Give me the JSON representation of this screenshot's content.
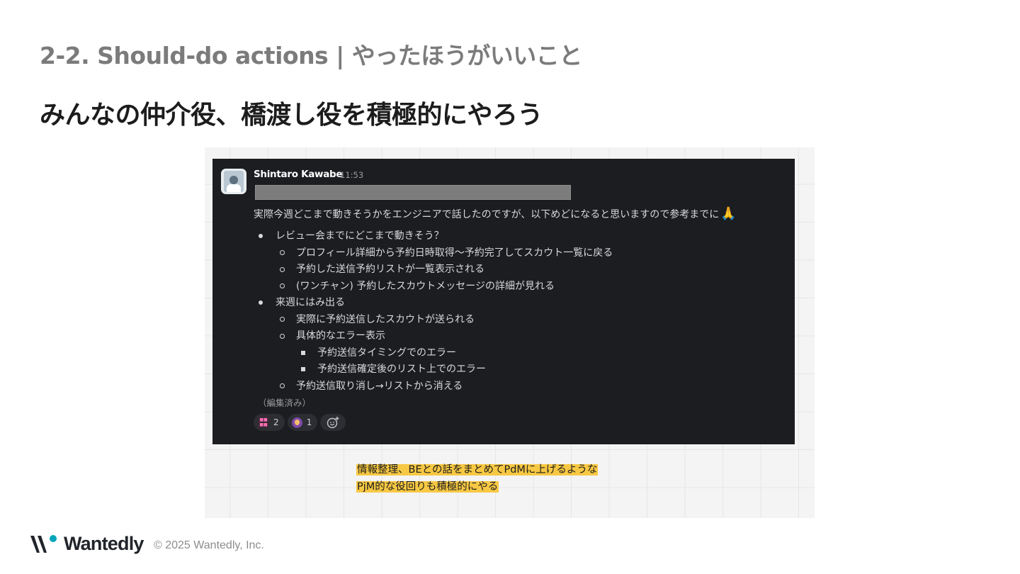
{
  "slide": {
    "section_title": "2-2. Should-do actions | やったほうがいいこと",
    "headline": "みんなの仲介役、橋渡し役を積極的にやろう"
  },
  "message": {
    "sender": "Shintaro Kawabe",
    "time": "11:53",
    "intro": "実際今週どこまで動きそうかをエンジニアで話したのですが、以下めどになると思いますので参考までに",
    "pray_emoji": "🙏",
    "items": [
      {
        "level": 1,
        "text": "レビュー会までにどこまで動きそう？"
      },
      {
        "level": 2,
        "text": "プロフィール詳細から予約日時取得〜予約完了してスカウト一覧に戻る"
      },
      {
        "level": 2,
        "text": "予約した送信予約リストが一覧表示される"
      },
      {
        "level": 2,
        "text": "(ワンチャン) 予約したスカウトメッセージの詳細が見れる"
      },
      {
        "level": 1,
        "text": "来週にはみ出る"
      },
      {
        "level": 2,
        "text": "実際に予約送信したスカウトが送られる"
      },
      {
        "level": 2,
        "text": "具体的なエラー表示"
      },
      {
        "level": 3,
        "text": "予約送信タイミングでのエラー"
      },
      {
        "level": 3,
        "text": "予約送信確定後のリスト上でのエラー"
      },
      {
        "level": 2,
        "text": "予約送信取り消し→リストから消える"
      }
    ],
    "edited_label": "（編集済み）",
    "reactions": [
      {
        "emoji": "custom-text-emoji",
        "count": "2"
      },
      {
        "emoji": "person-emoji",
        "count": "1"
      }
    ]
  },
  "annotation": {
    "line1": "情報整理、BEとの話をまとめてPdMに上げるような",
    "line2": "PjM的な役回りも積極的にやる",
    "highlight_color": "#f7c843"
  },
  "footer": {
    "brand": "Wantedly",
    "copyright": "© 2025 Wantedly, Inc."
  }
}
